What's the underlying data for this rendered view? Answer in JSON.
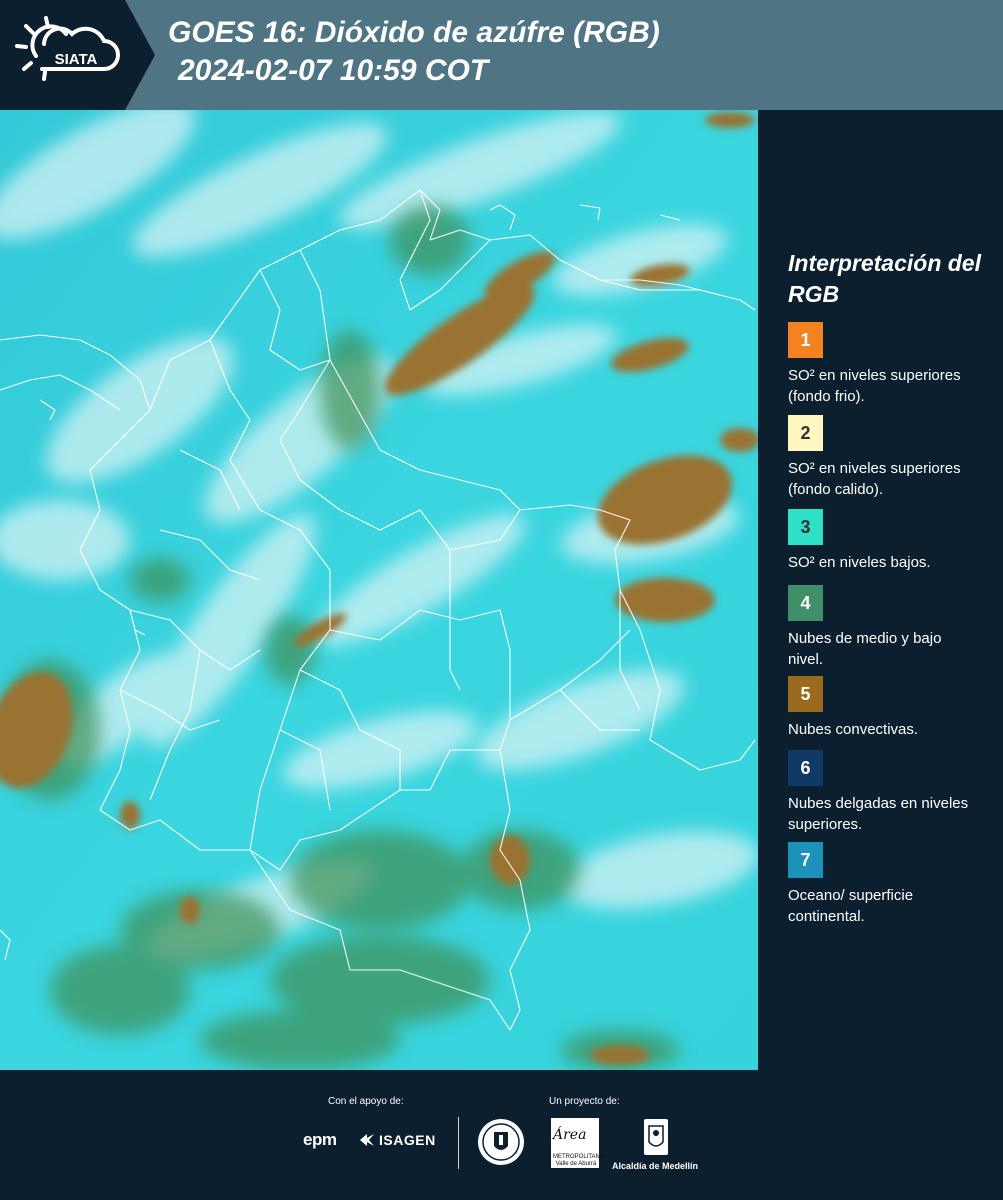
{
  "header": {
    "logo_text": "SIATA",
    "title_line1": "GOES 16: Dióxido de azúfre (RGB)",
    "title_line2": "2024-02-07 10:59 COT"
  },
  "legend": {
    "title": "Interpretación del RGB",
    "items": [
      {
        "number": "1",
        "color": "#f58220",
        "text_color": "#ffffff",
        "label": "SO² en niveles superiores (fondo frio)."
      },
      {
        "number": "2",
        "color": "#fff6c0",
        "text_color": "#333333",
        "label": "SO² en niveles superiores (fondo calido)."
      },
      {
        "number": "3",
        "color": "#2de0c6",
        "text_color": "#333333",
        "label": "SO² en niveles bajos."
      },
      {
        "number": "4",
        "color": "#3f8f68",
        "text_color": "#ffffff",
        "label": "Nubes de medio y bajo nivel."
      },
      {
        "number": "5",
        "color": "#9a6a1e",
        "text_color": "#ffffff",
        "label": "Nubes convectivas."
      },
      {
        "number": "6",
        "color": "#103a66",
        "text_color": "#ffffff",
        "label": "Nubes delgadas en niveles superiores."
      },
      {
        "number": "7",
        "color": "#1c92bb",
        "text_color": "#ffffff",
        "label": "Oceano/ superficie continental."
      }
    ]
  },
  "footer": {
    "support_label": "Con el apoyo de:",
    "project_label": "Un proyecto de:",
    "sponsor_epm": "epm",
    "sponsor_isagen": "ISAGEN",
    "partner_area_script": "Área",
    "partner_area_sub": "METROPOLITANA Valle de Aburrá",
    "partner_alcaldia": "Alcaldía de Medellín"
  },
  "map": {
    "colors": {
      "surface": "#38d5df",
      "low_cloud": "#3f8f55",
      "convective": "#9a7230",
      "thin_cloud": "#cdeff2",
      "border": "#ffffff"
    }
  }
}
